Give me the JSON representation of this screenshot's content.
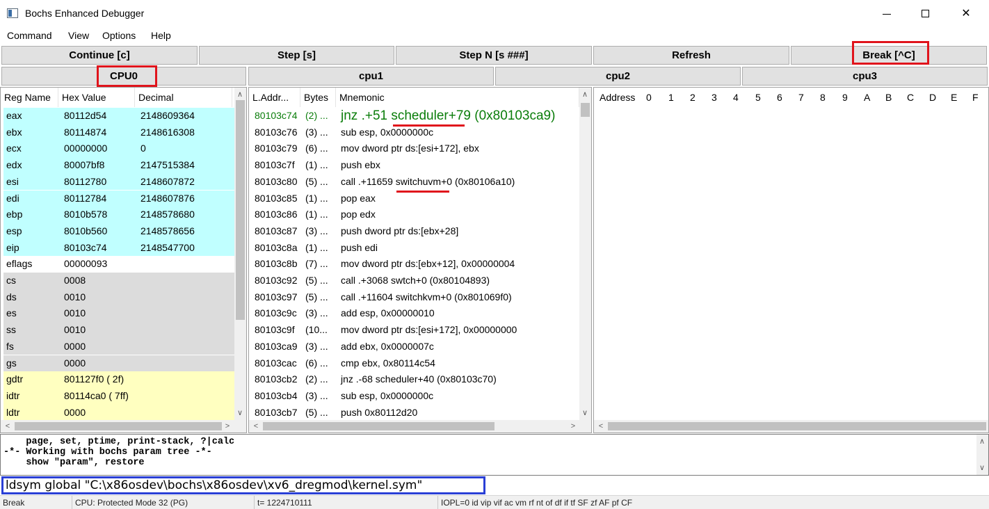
{
  "window": {
    "title": "Bochs Enhanced Debugger"
  },
  "menu": [
    "Command",
    "View",
    "Options",
    "Help"
  ],
  "toolbar": {
    "continue": "Continue [c]",
    "step": "Step [s]",
    "step_n": "Step N [s ###]",
    "refresh": "Refresh",
    "break": "Break [^C]"
  },
  "cpu_tabs": [
    "CPU0",
    "cpu1",
    "cpu2",
    "cpu3"
  ],
  "registers": {
    "headers": [
      "Reg Name",
      "Hex Value",
      "Decimal"
    ],
    "rows": [
      [
        "eax",
        "80112d54",
        "2148609364"
      ],
      [
        "ebx",
        "80114874",
        "2148616308"
      ],
      [
        "ecx",
        "00000000",
        "0"
      ],
      [
        "edx",
        "80007bf8",
        "2147515384"
      ],
      [
        "esi",
        "80112780",
        "2148607872"
      ],
      [
        "edi",
        "80112784",
        "2148607876"
      ],
      [
        "ebp",
        "8010b578",
        "2148578680"
      ],
      [
        "esp",
        "8010b560",
        "2148578656"
      ],
      [
        "eip",
        "80103c74",
        "2148547700"
      ],
      [
        "eflags",
        "00000093",
        ""
      ],
      [
        "cs",
        "0008",
        ""
      ],
      [
        "ds",
        "0010",
        ""
      ],
      [
        "es",
        "0010",
        ""
      ],
      [
        "ss",
        "0010",
        ""
      ],
      [
        "fs",
        "0000",
        ""
      ],
      [
        "gs",
        "0000",
        ""
      ],
      [
        "gdtr",
        "801127f0 (  2f)",
        ""
      ],
      [
        "idtr",
        "80114ca0 ( 7ff)",
        ""
      ],
      [
        "ldtr",
        "0000",
        ""
      ]
    ]
  },
  "disasm": {
    "headers": [
      "L.Addr...",
      "Bytes",
      "Mnemonic"
    ],
    "rows": [
      [
        "80103c74",
        "(2) ...",
        "jnz .+51 scheduler+79 (0x80103ca9)"
      ],
      [
        "80103c76",
        "(3) ...",
        "sub esp, 0x0000000c"
      ],
      [
        "80103c79",
        "(6) ...",
        "mov dword ptr ds:[esi+172], ebx"
      ],
      [
        "80103c7f",
        "(1) ...",
        "push ebx"
      ],
      [
        "80103c80",
        "(5) ...",
        "call .+11659 switchuvm+0 (0x80106a10)"
      ],
      [
        "80103c85",
        "(1) ...",
        "pop eax"
      ],
      [
        "80103c86",
        "(1) ...",
        "pop edx"
      ],
      [
        "80103c87",
        "(3) ...",
        "push dword ptr ds:[ebx+28]"
      ],
      [
        "80103c8a",
        "(1) ...",
        "push edi"
      ],
      [
        "80103c8b",
        "(7) ...",
        "mov dword ptr ds:[ebx+12], 0x00000004"
      ],
      [
        "80103c92",
        "(5) ...",
        "call .+3068 swtch+0 (0x80104893)"
      ],
      [
        "80103c97",
        "(5) ...",
        "call .+11604 switchkvm+0 (0x801069f0)"
      ],
      [
        "80103c9c",
        "(3) ...",
        "add esp, 0x00000010"
      ],
      [
        "80103c9f",
        "(10...",
        "mov dword ptr ds:[esi+172], 0x00000000"
      ],
      [
        "80103ca9",
        "(3) ...",
        "add ebx, 0x0000007c"
      ],
      [
        "80103cac",
        "(6) ...",
        "cmp ebx, 0x80114c54"
      ],
      [
        "80103cb2",
        "(2) ...",
        "jnz .-68 scheduler+40 (0x80103c70)"
      ],
      [
        "80103cb4",
        "(3) ...",
        "sub esp, 0x0000000c"
      ],
      [
        "80103cb7",
        "(5) ...",
        "push 0x80112d20"
      ]
    ]
  },
  "memory": {
    "headers": [
      "Address",
      "0",
      "1",
      "2",
      "3",
      "4",
      "5",
      "6",
      "7",
      "8",
      "9",
      "A",
      "B",
      "C",
      "D",
      "E",
      "F"
    ]
  },
  "console": {
    "lines": [
      "    page, set, ptime, print-stack, ?|calc",
      "-*- Working with bochs param tree -*-",
      "    show \"param\", restore"
    ]
  },
  "command_input": "ldsym global \"C:\\x86osdev\\bochs\\x86osdev\\xv6_dregmod\\kernel.sym\"",
  "status": {
    "state": "Break",
    "cpu_mode": "CPU: Protected Mode 32 (PG)",
    "ticks": "t= 1224710111",
    "flags": "IOPL=0 id vip vif ac vm rf nt of df if tf SF zf AF pf CF"
  },
  "colors": {
    "highlight_box": "#e0141c",
    "input_box": "#2a3fd6",
    "current_line": "#0a7d0a",
    "reg_cyan": "#c0ffff",
    "reg_gray": "#dcdcdc",
    "reg_yellow": "#ffffc0"
  }
}
